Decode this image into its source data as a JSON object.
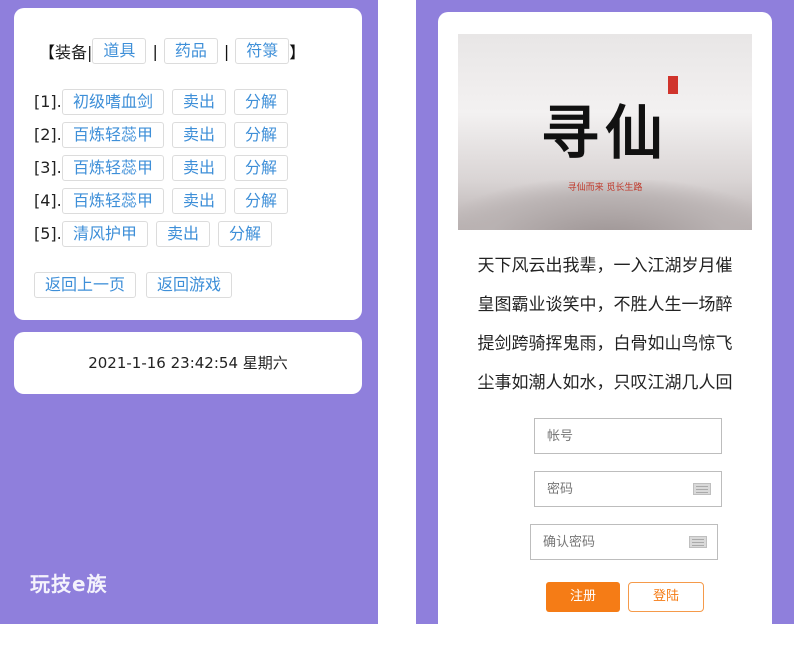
{
  "menu": {
    "open_bracket": "【",
    "equip_label": "装备|",
    "tabs": [
      {
        "label": "道具"
      },
      {
        "label": "药品"
      },
      {
        "label": "符箓"
      }
    ],
    "separator": "|",
    "close_bracket": "】"
  },
  "items": [
    {
      "index": "[1].",
      "name": "初级嗜血剑",
      "sell": "卖出",
      "decompose": "分解"
    },
    {
      "index": "[2].",
      "name": "百炼轻蕊甲",
      "sell": "卖出",
      "decompose": "分解"
    },
    {
      "index": "[3].",
      "name": "百炼轻蕊甲",
      "sell": "卖出",
      "decompose": "分解"
    },
    {
      "index": "[4].",
      "name": "百炼轻蕊甲",
      "sell": "卖出",
      "decompose": "分解"
    },
    {
      "index": "[5].",
      "name": "清风护甲",
      "sell": "卖出",
      "decompose": "分解"
    }
  ],
  "nav": {
    "back_label": "返回上一页",
    "game_label": "返回游戏"
  },
  "status": {
    "datetime": "2021-1-16 23:42:54 星期六"
  },
  "watermark": "玩技e族",
  "banner": {
    "title": "寻仙",
    "subtitle": "寻仙而来 觅长生路"
  },
  "poem": [
    "天下风云出我辈，一入江湖岁月催",
    "皇图霸业谈笑中，不胜人生一场醉",
    "提剑跨骑挥鬼雨，白骨如山鸟惊飞",
    "尘事如潮人如水，只叹江湖几人回"
  ],
  "form": {
    "account_placeholder": "帐号",
    "password_placeholder": "密码",
    "confirm_placeholder": "确认密码",
    "register_label": "注册",
    "login_label": "登陆"
  },
  "colors": {
    "panel_bg": "#8f7fdc",
    "link_blue": "#3e8fd8",
    "accent_orange": "#f57c16"
  }
}
